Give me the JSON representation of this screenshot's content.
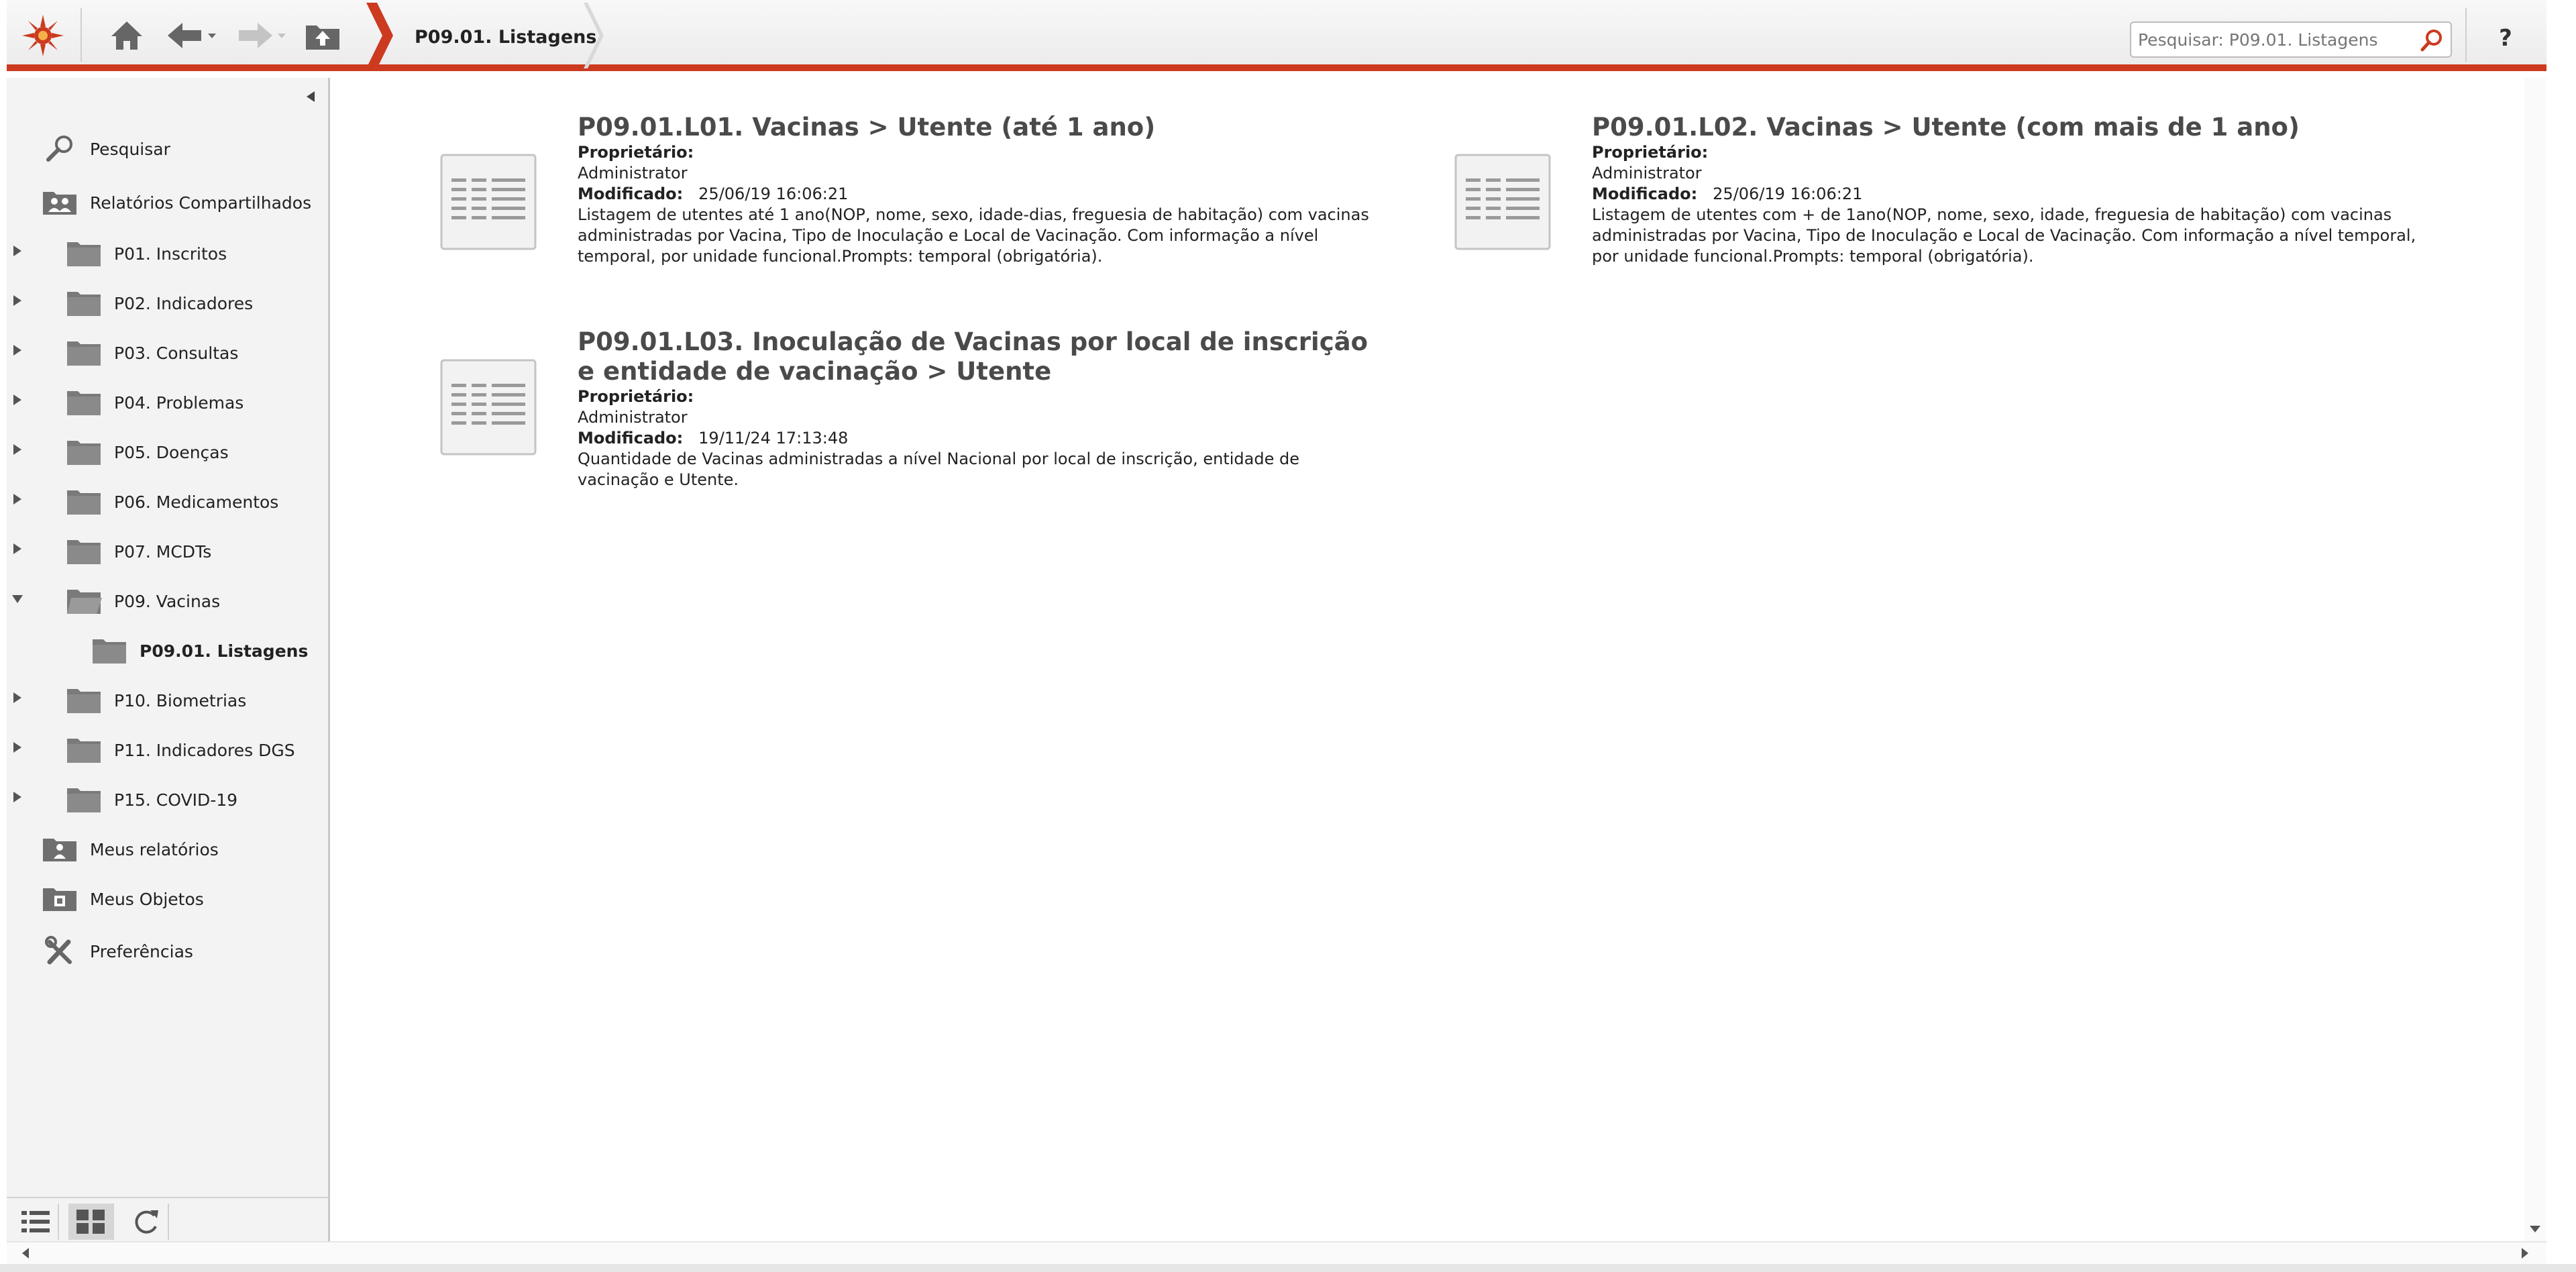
{
  "breadcrumb": {
    "current": "P09.01. Listagens"
  },
  "search": {
    "placeholder": "Pesquisar: P09.01. Listagens"
  },
  "help": {
    "label": "?"
  },
  "sidebar": {
    "search_label": "Pesquisar",
    "shared_reports_label": "Relatórios Compartilhados",
    "folders": [
      {
        "label": "P01. Inscritos",
        "expanded": false
      },
      {
        "label": "P02. Indicadores",
        "expanded": false
      },
      {
        "label": "P03. Consultas",
        "expanded": false
      },
      {
        "label": "P04. Problemas",
        "expanded": false
      },
      {
        "label": "P05. Doenças",
        "expanded": false
      },
      {
        "label": "P06. Medicamentos",
        "expanded": false
      },
      {
        "label": "P07. MCDTs",
        "expanded": false
      },
      {
        "label": "P09.  Vacinas",
        "expanded": true
      },
      {
        "label": "P09.01. Listagens",
        "selected": true
      },
      {
        "label": "P10. Biometrias",
        "expanded": false
      },
      {
        "label": "P11. Indicadores DGS",
        "expanded": false
      },
      {
        "label": "P15. COVID-19",
        "expanded": false
      }
    ],
    "my_reports_label": "Meus relatórios",
    "my_objects_label": "Meus Objetos",
    "preferences_label": "Preferências"
  },
  "reports": [
    {
      "title": "P09.01.L01. Vacinas > Utente (até 1 ano)",
      "owner_label": "Proprietário:",
      "owner": "Administrator",
      "modified_label": "Modificado:",
      "modified": "25/06/19 16:06:21",
      "description": "Listagem de utentes até 1 ano(NOP, nome, sexo, idade-dias, freguesia de habitação) com vacinas administradas por Vacina, Tipo de Inoculação e Local de Vacinação. Com informação a nível temporal, por unidade funcional.Prompts: temporal (obrigatória)."
    },
    {
      "title": "P09.01.L02. Vacinas > Utente (com mais de 1 ano)",
      "owner_label": "Proprietário:",
      "owner": "Administrator",
      "modified_label": "Modificado:",
      "modified": "25/06/19 16:06:21",
      "description": "Listagem de utentes com + de 1ano(NOP, nome, sexo, idade, freguesia de habitação) com vacinas administradas por Vacina, Tipo de Inoculação e Local de Vacinação. Com informação a nível temporal, por unidade funcional.Prompts: temporal (obrigatória)."
    },
    {
      "title": "P09.01.L03. Inoculação de Vacinas por local de inscrição e entidade de vacinação > Utente",
      "owner_label": "Proprietário:",
      "owner": "Administrator",
      "modified_label": "Modificado:",
      "modified": "19/11/24 17:13:48",
      "description": "Quantidade de Vacinas administradas a nível Nacional por local de inscrição, entidade de vacinação e Utente."
    }
  ],
  "colors": {
    "accent": "#cc3a1f",
    "sidebar_bg": "#f3f3f3",
    "folder": "#7a7a7a"
  }
}
